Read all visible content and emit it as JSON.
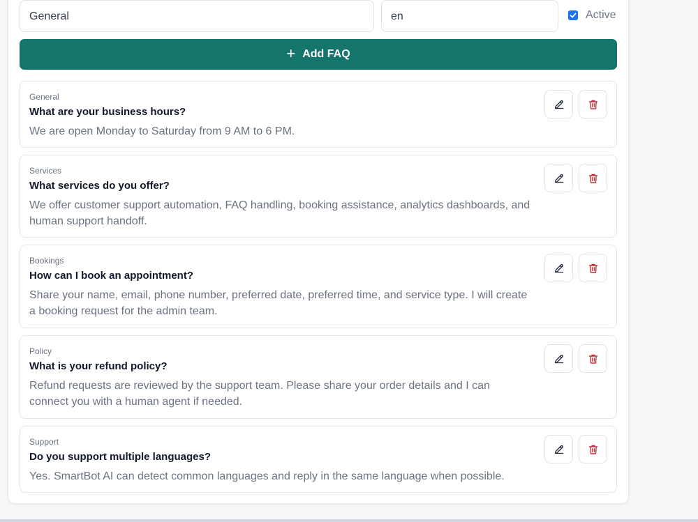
{
  "form": {
    "category_value": "General",
    "language_value": "en",
    "active_label": "Active",
    "active_checked": true
  },
  "add_button_label": "Add FAQ",
  "colors": {
    "primary": "#13756b",
    "delete": "#c2333b",
    "checkbox": "#1a73e8"
  },
  "faqs": [
    {
      "category": "General",
      "question": "What are your business hours?",
      "answer": "We are open Monday to Saturday from 9 AM to 6 PM."
    },
    {
      "category": "Services",
      "question": "What services do you offer?",
      "answer": "We offer customer support automation, FAQ handling, booking assistance, analytics dashboards, and human support handoff."
    },
    {
      "category": "Bookings",
      "question": "How can I book an appointment?",
      "answer": "Share your name, email, phone number, preferred date, preferred time, and service type. I will create a booking request for the admin team."
    },
    {
      "category": "Policy",
      "question": "What is your refund policy?",
      "answer": "Refund requests are reviewed by the support team. Please share your order details and I can connect you with a human agent if needed."
    },
    {
      "category": "Support",
      "question": "Do you support multiple languages?",
      "answer": "Yes. SmartBot AI can detect common languages and reply in the same language when possible."
    }
  ]
}
